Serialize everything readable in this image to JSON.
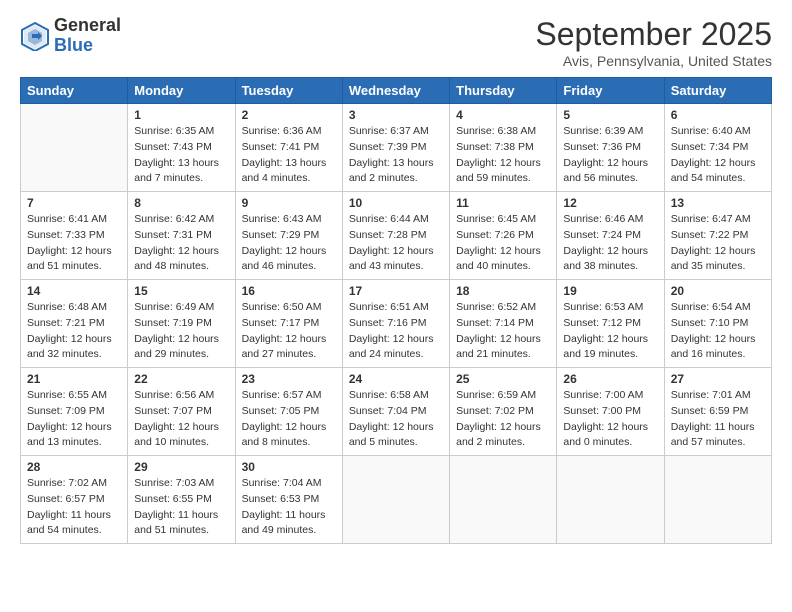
{
  "header": {
    "logo_general": "General",
    "logo_blue": "Blue",
    "month_title": "September 2025",
    "location": "Avis, Pennsylvania, United States"
  },
  "days_of_week": [
    "Sunday",
    "Monday",
    "Tuesday",
    "Wednesday",
    "Thursday",
    "Friday",
    "Saturday"
  ],
  "weeks": [
    [
      {
        "day": "",
        "empty": true
      },
      {
        "day": "1",
        "sunrise": "Sunrise: 6:35 AM",
        "sunset": "Sunset: 7:43 PM",
        "daylight": "Daylight: 13 hours and 7 minutes."
      },
      {
        "day": "2",
        "sunrise": "Sunrise: 6:36 AM",
        "sunset": "Sunset: 7:41 PM",
        "daylight": "Daylight: 13 hours and 4 minutes."
      },
      {
        "day": "3",
        "sunrise": "Sunrise: 6:37 AM",
        "sunset": "Sunset: 7:39 PM",
        "daylight": "Daylight: 13 hours and 2 minutes."
      },
      {
        "day": "4",
        "sunrise": "Sunrise: 6:38 AM",
        "sunset": "Sunset: 7:38 PM",
        "daylight": "Daylight: 12 hours and 59 minutes."
      },
      {
        "day": "5",
        "sunrise": "Sunrise: 6:39 AM",
        "sunset": "Sunset: 7:36 PM",
        "daylight": "Daylight: 12 hours and 56 minutes."
      },
      {
        "day": "6",
        "sunrise": "Sunrise: 6:40 AM",
        "sunset": "Sunset: 7:34 PM",
        "daylight": "Daylight: 12 hours and 54 minutes."
      }
    ],
    [
      {
        "day": "7",
        "sunrise": "Sunrise: 6:41 AM",
        "sunset": "Sunset: 7:33 PM",
        "daylight": "Daylight: 12 hours and 51 minutes."
      },
      {
        "day": "8",
        "sunrise": "Sunrise: 6:42 AM",
        "sunset": "Sunset: 7:31 PM",
        "daylight": "Daylight: 12 hours and 48 minutes."
      },
      {
        "day": "9",
        "sunrise": "Sunrise: 6:43 AM",
        "sunset": "Sunset: 7:29 PM",
        "daylight": "Daylight: 12 hours and 46 minutes."
      },
      {
        "day": "10",
        "sunrise": "Sunrise: 6:44 AM",
        "sunset": "Sunset: 7:28 PM",
        "daylight": "Daylight: 12 hours and 43 minutes."
      },
      {
        "day": "11",
        "sunrise": "Sunrise: 6:45 AM",
        "sunset": "Sunset: 7:26 PM",
        "daylight": "Daylight: 12 hours and 40 minutes."
      },
      {
        "day": "12",
        "sunrise": "Sunrise: 6:46 AM",
        "sunset": "Sunset: 7:24 PM",
        "daylight": "Daylight: 12 hours and 38 minutes."
      },
      {
        "day": "13",
        "sunrise": "Sunrise: 6:47 AM",
        "sunset": "Sunset: 7:22 PM",
        "daylight": "Daylight: 12 hours and 35 minutes."
      }
    ],
    [
      {
        "day": "14",
        "sunrise": "Sunrise: 6:48 AM",
        "sunset": "Sunset: 7:21 PM",
        "daylight": "Daylight: 12 hours and 32 minutes."
      },
      {
        "day": "15",
        "sunrise": "Sunrise: 6:49 AM",
        "sunset": "Sunset: 7:19 PM",
        "daylight": "Daylight: 12 hours and 29 minutes."
      },
      {
        "day": "16",
        "sunrise": "Sunrise: 6:50 AM",
        "sunset": "Sunset: 7:17 PM",
        "daylight": "Daylight: 12 hours and 27 minutes."
      },
      {
        "day": "17",
        "sunrise": "Sunrise: 6:51 AM",
        "sunset": "Sunset: 7:16 PM",
        "daylight": "Daylight: 12 hours and 24 minutes."
      },
      {
        "day": "18",
        "sunrise": "Sunrise: 6:52 AM",
        "sunset": "Sunset: 7:14 PM",
        "daylight": "Daylight: 12 hours and 21 minutes."
      },
      {
        "day": "19",
        "sunrise": "Sunrise: 6:53 AM",
        "sunset": "Sunset: 7:12 PM",
        "daylight": "Daylight: 12 hours and 19 minutes."
      },
      {
        "day": "20",
        "sunrise": "Sunrise: 6:54 AM",
        "sunset": "Sunset: 7:10 PM",
        "daylight": "Daylight: 12 hours and 16 minutes."
      }
    ],
    [
      {
        "day": "21",
        "sunrise": "Sunrise: 6:55 AM",
        "sunset": "Sunset: 7:09 PM",
        "daylight": "Daylight: 12 hours and 13 minutes."
      },
      {
        "day": "22",
        "sunrise": "Sunrise: 6:56 AM",
        "sunset": "Sunset: 7:07 PM",
        "daylight": "Daylight: 12 hours and 10 minutes."
      },
      {
        "day": "23",
        "sunrise": "Sunrise: 6:57 AM",
        "sunset": "Sunset: 7:05 PM",
        "daylight": "Daylight: 12 hours and 8 minutes."
      },
      {
        "day": "24",
        "sunrise": "Sunrise: 6:58 AM",
        "sunset": "Sunset: 7:04 PM",
        "daylight": "Daylight: 12 hours and 5 minutes."
      },
      {
        "day": "25",
        "sunrise": "Sunrise: 6:59 AM",
        "sunset": "Sunset: 7:02 PM",
        "daylight": "Daylight: 12 hours and 2 minutes."
      },
      {
        "day": "26",
        "sunrise": "Sunrise: 7:00 AM",
        "sunset": "Sunset: 7:00 PM",
        "daylight": "Daylight: 12 hours and 0 minutes."
      },
      {
        "day": "27",
        "sunrise": "Sunrise: 7:01 AM",
        "sunset": "Sunset: 6:59 PM",
        "daylight": "Daylight: 11 hours and 57 minutes."
      }
    ],
    [
      {
        "day": "28",
        "sunrise": "Sunrise: 7:02 AM",
        "sunset": "Sunset: 6:57 PM",
        "daylight": "Daylight: 11 hours and 54 minutes."
      },
      {
        "day": "29",
        "sunrise": "Sunrise: 7:03 AM",
        "sunset": "Sunset: 6:55 PM",
        "daylight": "Daylight: 11 hours and 51 minutes."
      },
      {
        "day": "30",
        "sunrise": "Sunrise: 7:04 AM",
        "sunset": "Sunset: 6:53 PM",
        "daylight": "Daylight: 11 hours and 49 minutes."
      },
      {
        "day": "",
        "empty": true
      },
      {
        "day": "",
        "empty": true
      },
      {
        "day": "",
        "empty": true
      },
      {
        "day": "",
        "empty": true
      }
    ]
  ]
}
